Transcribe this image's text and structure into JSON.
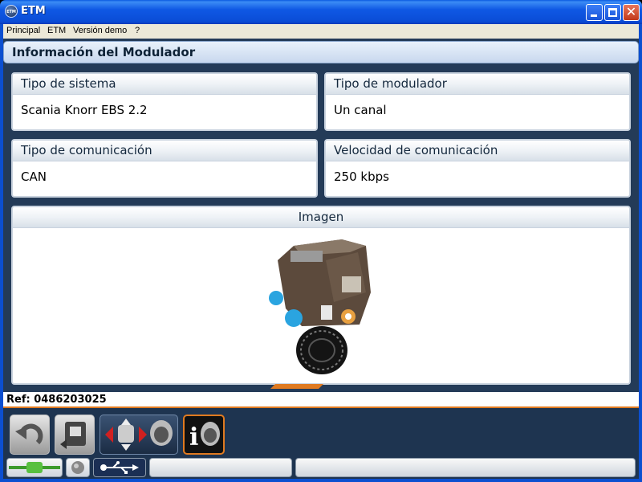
{
  "window": {
    "title": "ETM",
    "icon_label": "ETM"
  },
  "menu": {
    "items": [
      "Principal",
      "ETM",
      "Versión demo",
      "?"
    ]
  },
  "page": {
    "header": "Información del Modulador"
  },
  "cards": {
    "tipo_sistema": {
      "label": "Tipo de sistema",
      "value": "Scania Knorr EBS 2.2"
    },
    "tipo_modulador": {
      "label": "Tipo de modulador",
      "value": "Un canal"
    },
    "tipo_comunicacion": {
      "label": "Tipo de comunicación",
      "value": "CAN"
    },
    "velocidad_comunicacion": {
      "label": "Velocidad de comunicación",
      "value": "250 kbps"
    },
    "imagen": {
      "label": "Imagen"
    }
  },
  "ref": {
    "text": "Ref: 0486203025"
  },
  "toolbar": {
    "buttons": [
      "back-icon",
      "diagnose-icon",
      "navigate-icon",
      "info-icon"
    ],
    "info_glyph": "i"
  },
  "statusbar": {
    "panels": [
      "connection-cable-icon",
      "status-led-icon",
      "usb-icon",
      "",
      ""
    ]
  },
  "colors": {
    "titlebar": "#0f58e4",
    "accent": "#e07a20",
    "background": "#243b58",
    "header_text": "#0e2236"
  }
}
